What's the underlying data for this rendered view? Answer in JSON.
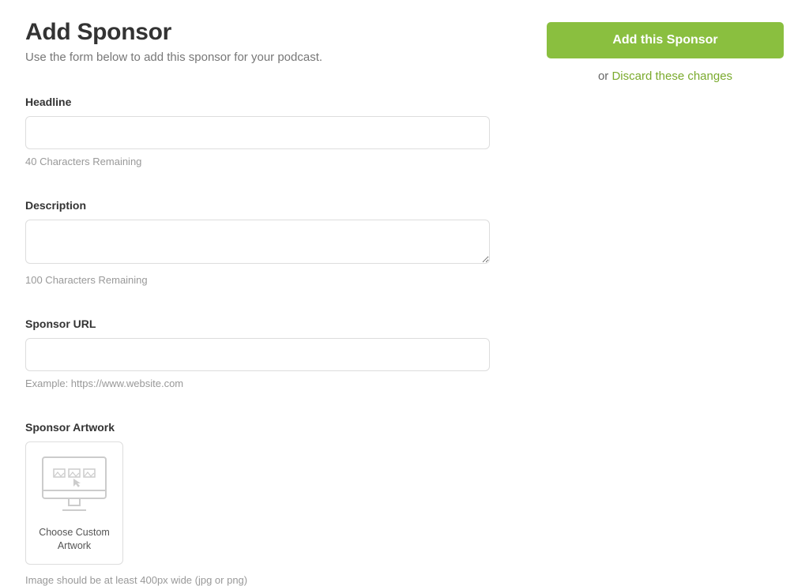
{
  "header": {
    "title": "Add Sponsor",
    "subtitle": "Use the form below to add this sponsor for your podcast."
  },
  "actions": {
    "add_label": "Add this Sponsor",
    "or_text": "or ",
    "discard_label": "Discard these changes"
  },
  "form": {
    "headline": {
      "label": "Headline",
      "value": "",
      "help": "40 Characters Remaining"
    },
    "description": {
      "label": "Description",
      "value": "",
      "help": "100 Characters Remaining"
    },
    "sponsor_url": {
      "label": "Sponsor URL",
      "value": "",
      "help": "Example: https://www.website.com"
    },
    "artwork": {
      "label": "Sponsor Artwork",
      "choose_label": "Choose Custom Artwork",
      "help": "Image should be at least 400px wide (jpg or png)"
    }
  },
  "colors": {
    "accent": "#8abf3f",
    "link": "#7aaa2d"
  }
}
